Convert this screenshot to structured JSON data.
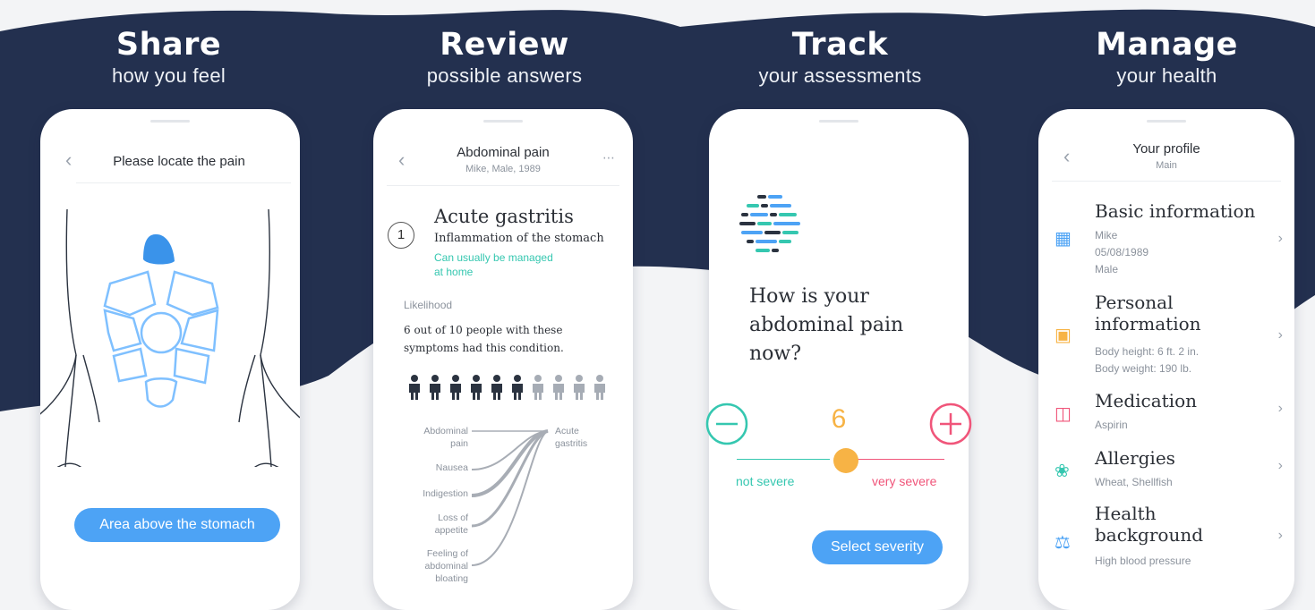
{
  "colors": {
    "navy": "#23304f",
    "blue": "#4da3f5",
    "teal": "#35c7b0",
    "pink": "#f0557a",
    "orange": "#f7b345",
    "light": "#f3f4f6"
  },
  "panels": [
    {
      "title": "Share",
      "subtitle": "how you feel"
    },
    {
      "title": "Review",
      "subtitle": "possible answers"
    },
    {
      "title": "Track",
      "subtitle": "your assessments"
    },
    {
      "title": "Manage",
      "subtitle": "your health"
    }
  ],
  "screen1": {
    "back_icon": "chevron-left-icon",
    "nav_title": "Please locate the pain",
    "button": "Area above the stomach"
  },
  "screen2": {
    "nav_title": "Abdominal pain",
    "nav_subtitle": "Mike, Male, 1989",
    "menu_icon": "more-dots-icon",
    "rank": "1",
    "condition": "Acute gastritis",
    "description": "Inflammation of the stomach",
    "note_line1": "Can usually be managed",
    "note_line2": "at home",
    "likelihood_label": "Likelihood",
    "likelihood_line1": "6 out of 10 people with these",
    "likelihood_line2": "symptoms had this condition.",
    "likelihood_value": 6,
    "likelihood_total": 10,
    "symptoms": [
      "Abdominal pain",
      "Nausea",
      "Indigestion",
      "Loss of appetite",
      "Feeling of abdominal bloating"
    ],
    "target": "Acute gastritis"
  },
  "screen3": {
    "question_line1": "How is your",
    "question_line2": "abdominal pain",
    "question_line3": "now?",
    "value": "6",
    "min_label": "not severe",
    "max_label": "very severe",
    "button": "Select severity",
    "slider_level": 0.5,
    "minus_icon": "minus-circle-icon",
    "plus_icon": "plus-circle-icon"
  },
  "screen4": {
    "nav_title": "Your profile",
    "nav_subtitle": "Main",
    "items": [
      {
        "title": "Basic information",
        "lines": [
          "Mike",
          "05/08/1989",
          "Male"
        ],
        "icon": "id-card-icon"
      },
      {
        "title": "Personal information",
        "lines": [
          "Body height: 6 ft. 2 in.",
          "Body weight: 190 lb."
        ],
        "icon": "person-card-icon"
      },
      {
        "title": "Medication",
        "lines": [
          "Aspirin"
        ],
        "icon": "pill-box-icon"
      },
      {
        "title": "Allergies",
        "lines": [
          "Wheat, Shellfish"
        ],
        "icon": "allergy-flower-icon"
      },
      {
        "title": "Health background",
        "lines": [
          "High blood pressure"
        ],
        "icon": "balance-scale-icon"
      }
    ]
  }
}
